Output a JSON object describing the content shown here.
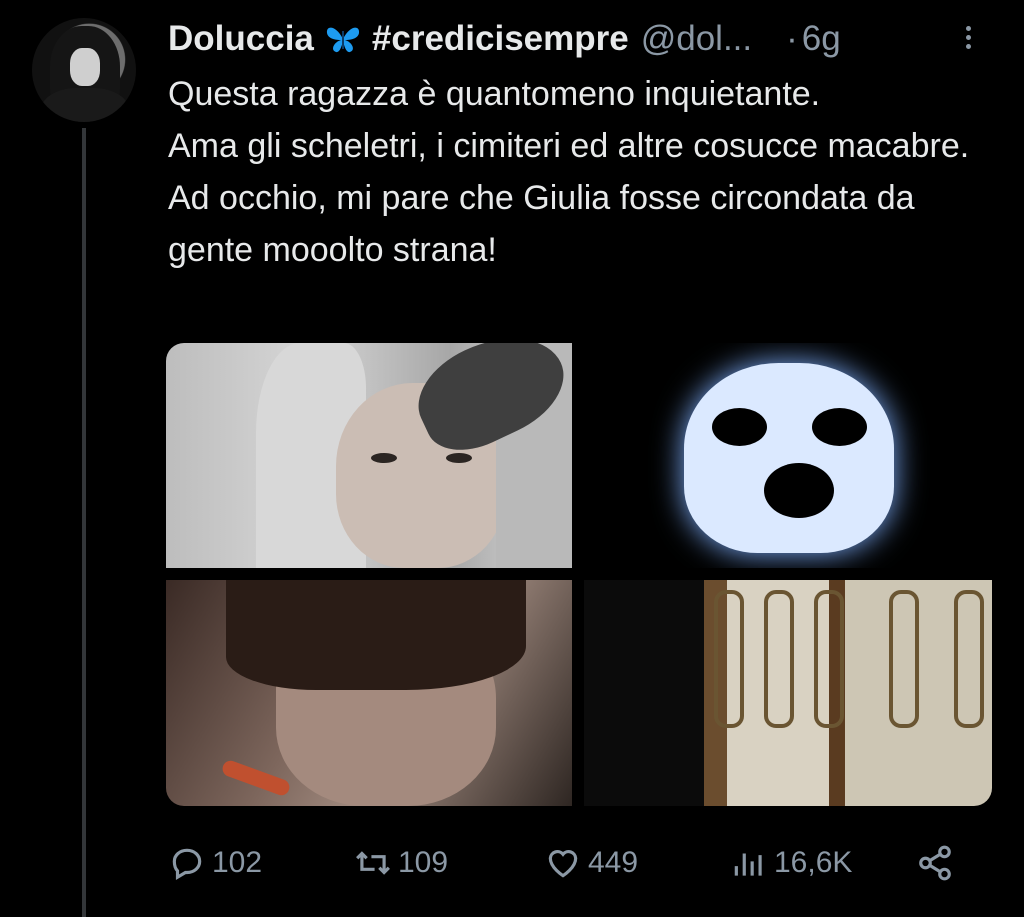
{
  "tweet": {
    "author_name": "Doluccia",
    "emoji": "butterfly-emoji",
    "hashtag": "#credicisempre",
    "handle": "@dol...",
    "separator": "·",
    "time": "6g",
    "text_lines": [
      "Questa ragazza è quantomeno inquietante.",
      "Ama gli scheletri, i cimiteri ed altre cosucce macabre.",
      "Ad occhio, mi pare che Giulia fosse circondata da gente mooolto strana!"
    ]
  },
  "actions": {
    "replies": "102",
    "reposts": "109",
    "likes": "449",
    "views": "16,6K"
  },
  "colors": {
    "background": "#000000",
    "text": "#e7e9ea",
    "secondary": "#8b98a5",
    "butterfly": "#1d9bf0"
  }
}
